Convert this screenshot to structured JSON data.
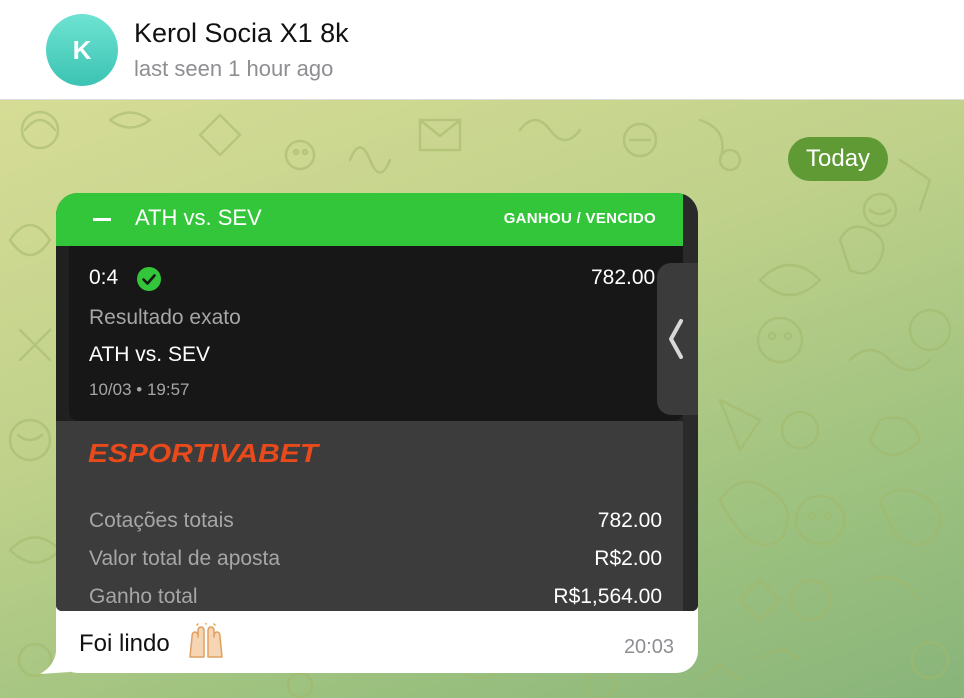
{
  "header": {
    "avatar_initial": "K",
    "contact_name": "Kerol Socia X1 8k",
    "status": "last seen 1 hour ago"
  },
  "chat": {
    "date_label": "Today"
  },
  "message": {
    "bet_slip": {
      "match_title": "ATH vs. SEV",
      "result_badge": "GANHOU / VENCIDO",
      "score": "0:4",
      "odds": "782.00",
      "market": "Resultado exato",
      "match_name": "ATH vs. SEV",
      "datetime": "10/03 • 19:57",
      "brand": "ESPORTIVABET",
      "rows": [
        {
          "label": "Cotações totais",
          "value": "782.00"
        },
        {
          "label": "Valor total de aposta",
          "value": "R$2.00"
        },
        {
          "label": "Ganho total",
          "value": "R$1,564.00"
        }
      ]
    },
    "caption": "Foi lindo",
    "time": "20:03"
  },
  "colors": {
    "brand_orange": "#e84a1c",
    "win_green": "#33c63a",
    "date_pill": "#5f9a35"
  },
  "icons": {
    "check": "check-circle-icon",
    "chevron": "chevron-left-icon",
    "emoji": "raising-hands-icon"
  }
}
